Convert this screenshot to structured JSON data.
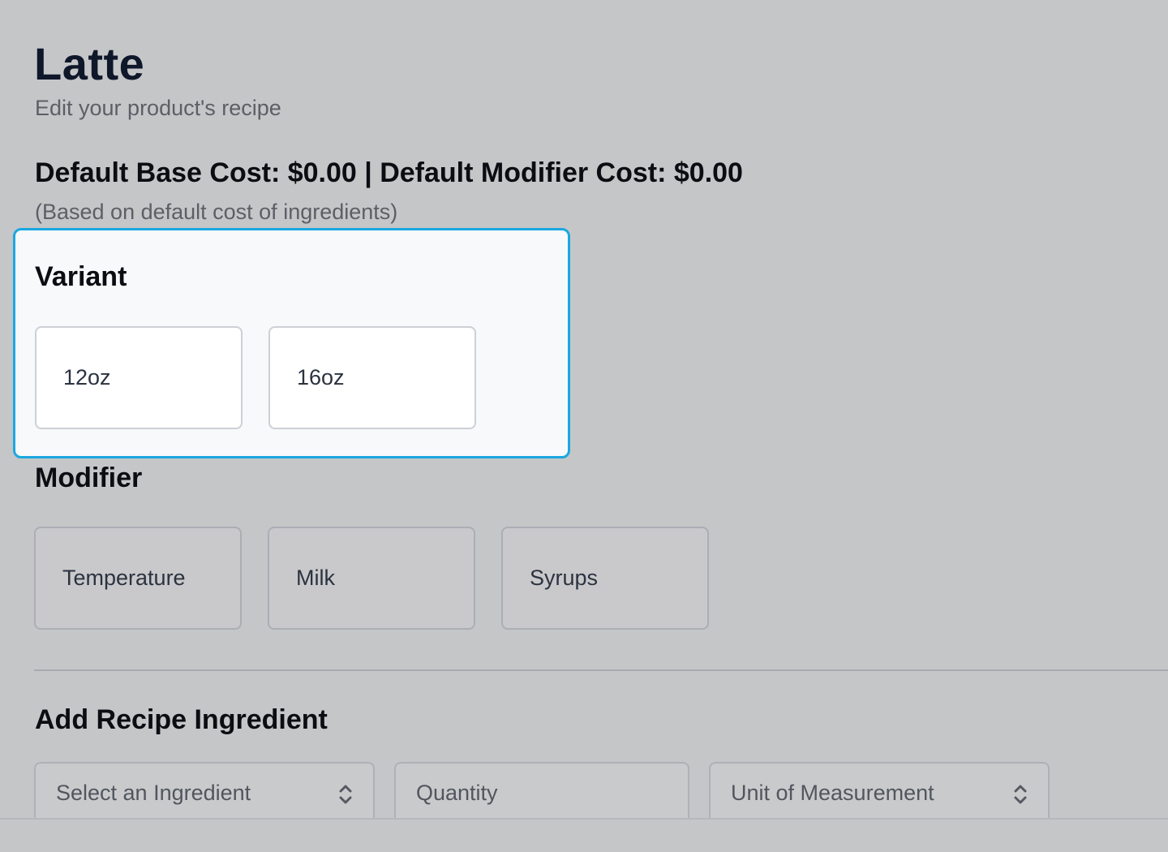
{
  "product": {
    "title": "Latte",
    "subtitle": "Edit your product's recipe"
  },
  "costs": {
    "summary": "Default Base Cost: $0.00 | Default Modifier Cost: $0.00",
    "note": "(Based on default cost of ingredients)"
  },
  "variant": {
    "heading": "Variant",
    "options": [
      {
        "label": "12oz"
      },
      {
        "label": "16oz"
      }
    ]
  },
  "modifier": {
    "heading": "Modifier",
    "options": [
      {
        "label": "Temperature"
      },
      {
        "label": "Milk"
      },
      {
        "label": "Syrups"
      }
    ]
  },
  "add_ingredient": {
    "heading": "Add Recipe Ingredient",
    "ingredient_select": "Select an Ingredient",
    "quantity_placeholder": "Quantity",
    "unit_select": "Unit of Measurement"
  },
  "colors": {
    "accent_border": "#1aa8e0",
    "background": "#c5c6c8"
  },
  "icons": {
    "select_chevron": "chevron-up-down-icon"
  }
}
